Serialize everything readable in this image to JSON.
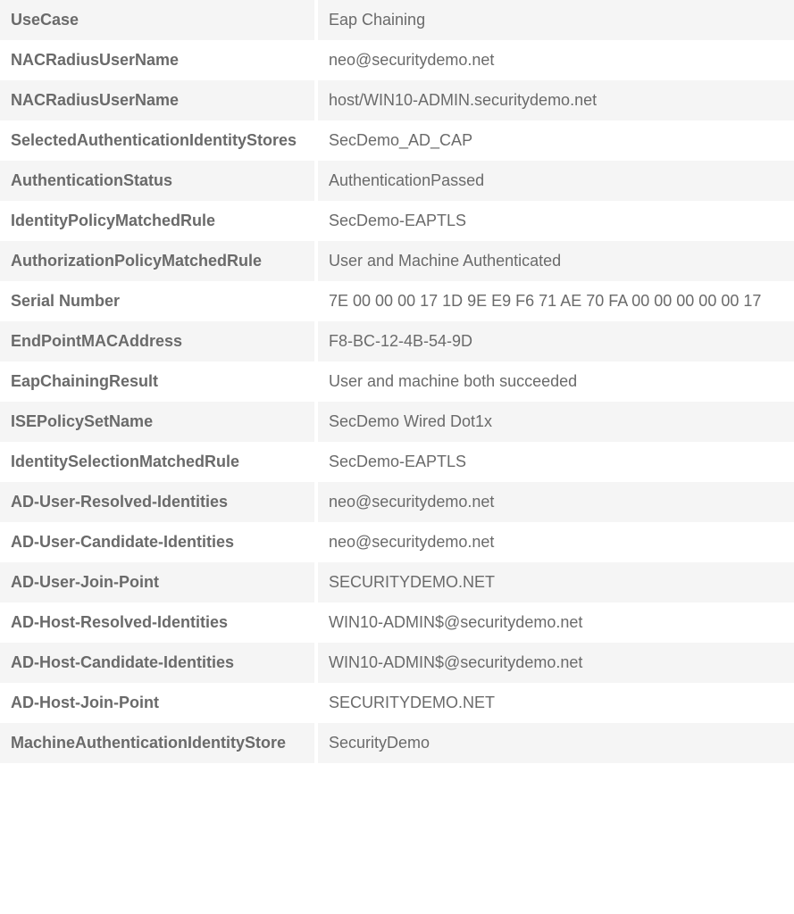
{
  "rows": [
    {
      "label": "UseCase",
      "value": "Eap Chaining"
    },
    {
      "label": "NACRadiusUserName",
      "value": "neo@securitydemo.net"
    },
    {
      "label": "NACRadiusUserName",
      "value": "host/WIN10-ADMIN.securitydemo.net"
    },
    {
      "label": "SelectedAuthenticationIdentityStores",
      "value": "SecDemo_AD_CAP"
    },
    {
      "label": "AuthenticationStatus",
      "value": "AuthenticationPassed"
    },
    {
      "label": "IdentityPolicyMatchedRule",
      "value": "SecDemo-EAPTLS"
    },
    {
      "label": "AuthorizationPolicyMatchedRule",
      "value": "User and Machine Authenticated"
    },
    {
      "label": "Serial Number",
      "value": "7E 00 00 00 17 1D 9E E9 F6 71 AE 70 FA 00 00 00 00 00 17"
    },
    {
      "label": "EndPointMACAddress",
      "value": "F8-BC-12-4B-54-9D"
    },
    {
      "label": "EapChainingResult",
      "value": "User and machine both succeeded"
    },
    {
      "label": "ISEPolicySetName",
      "value": "SecDemo Wired Dot1x"
    },
    {
      "label": "IdentitySelectionMatchedRule",
      "value": "SecDemo-EAPTLS"
    },
    {
      "label": "AD-User-Resolved-Identities",
      "value": "neo@securitydemo.net"
    },
    {
      "label": "AD-User-Candidate-Identities",
      "value": "neo@securitydemo.net"
    },
    {
      "label": "AD-User-Join-Point",
      "value": "SECURITYDEMO.NET"
    },
    {
      "label": "AD-Host-Resolved-Identities",
      "value": "WIN10-ADMIN$@securitydemo.net"
    },
    {
      "label": "AD-Host-Candidate-Identities",
      "value": "WIN10-ADMIN$@securitydemo.net"
    },
    {
      "label": "AD-Host-Join-Point",
      "value": "SECURITYDEMO.NET"
    },
    {
      "label": "MachineAuthenticationIdentityStore",
      "value": "SecurityDemo"
    }
  ]
}
